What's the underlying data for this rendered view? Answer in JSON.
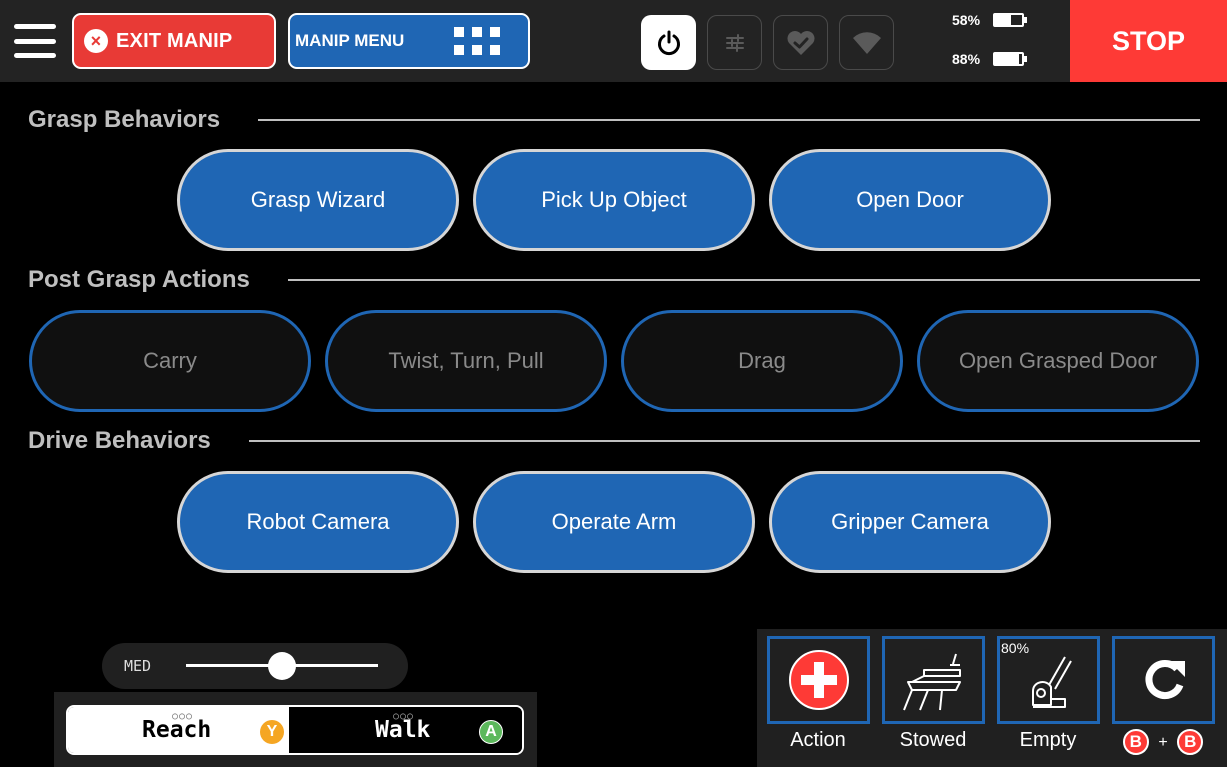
{
  "topbar": {
    "exit_label": "EXIT MANIP",
    "menu_label": "MANIP MENU",
    "battery_1": {
      "percent_text": "58%",
      "level": 0.58
    },
    "battery_2": {
      "percent_text": "88%",
      "level": 0.88
    },
    "stop_label": "STOP",
    "icons": [
      "menu-icon",
      "close-circle-icon",
      "grid-icon",
      "power-icon",
      "sliders-icon",
      "heart-check-icon",
      "wifi-icon"
    ]
  },
  "sections": {
    "grasp": {
      "title": "Grasp Behaviors",
      "buttons": [
        "Grasp Wizard",
        "Pick Up Object",
        "Open Door"
      ]
    },
    "post_grasp": {
      "title": "Post Grasp Actions",
      "buttons": [
        "Carry",
        "Twist, Turn, Pull",
        "Drag",
        "Open Grasped Door"
      ]
    },
    "drive": {
      "title": "Drive Behaviors",
      "buttons": [
        "Robot Camera",
        "Operate Arm",
        "Gripper Camera"
      ]
    }
  },
  "speed": {
    "label": "MED",
    "level": 0.5
  },
  "mode": {
    "reach": {
      "label": "Reach",
      "dots": "○○○",
      "button": "Y"
    },
    "walk": {
      "label": "Walk",
      "dots": "○○○",
      "button": "A"
    },
    "selected": "reach"
  },
  "actions": {
    "action": {
      "label": "Action"
    },
    "stowed": {
      "label": "Stowed"
    },
    "empty": {
      "label": "Empty",
      "percent": "80%"
    },
    "reset": {
      "combo_button": "B",
      "combo_joiner": "+"
    }
  },
  "colors": {
    "accent_blue": "#1f66b4",
    "stop_red": "#fe3a36",
    "exit_red": "#e83a36",
    "badge_yellow": "#f5a623",
    "badge_green": "#5cb85c",
    "topbar_bg": "#232323"
  }
}
